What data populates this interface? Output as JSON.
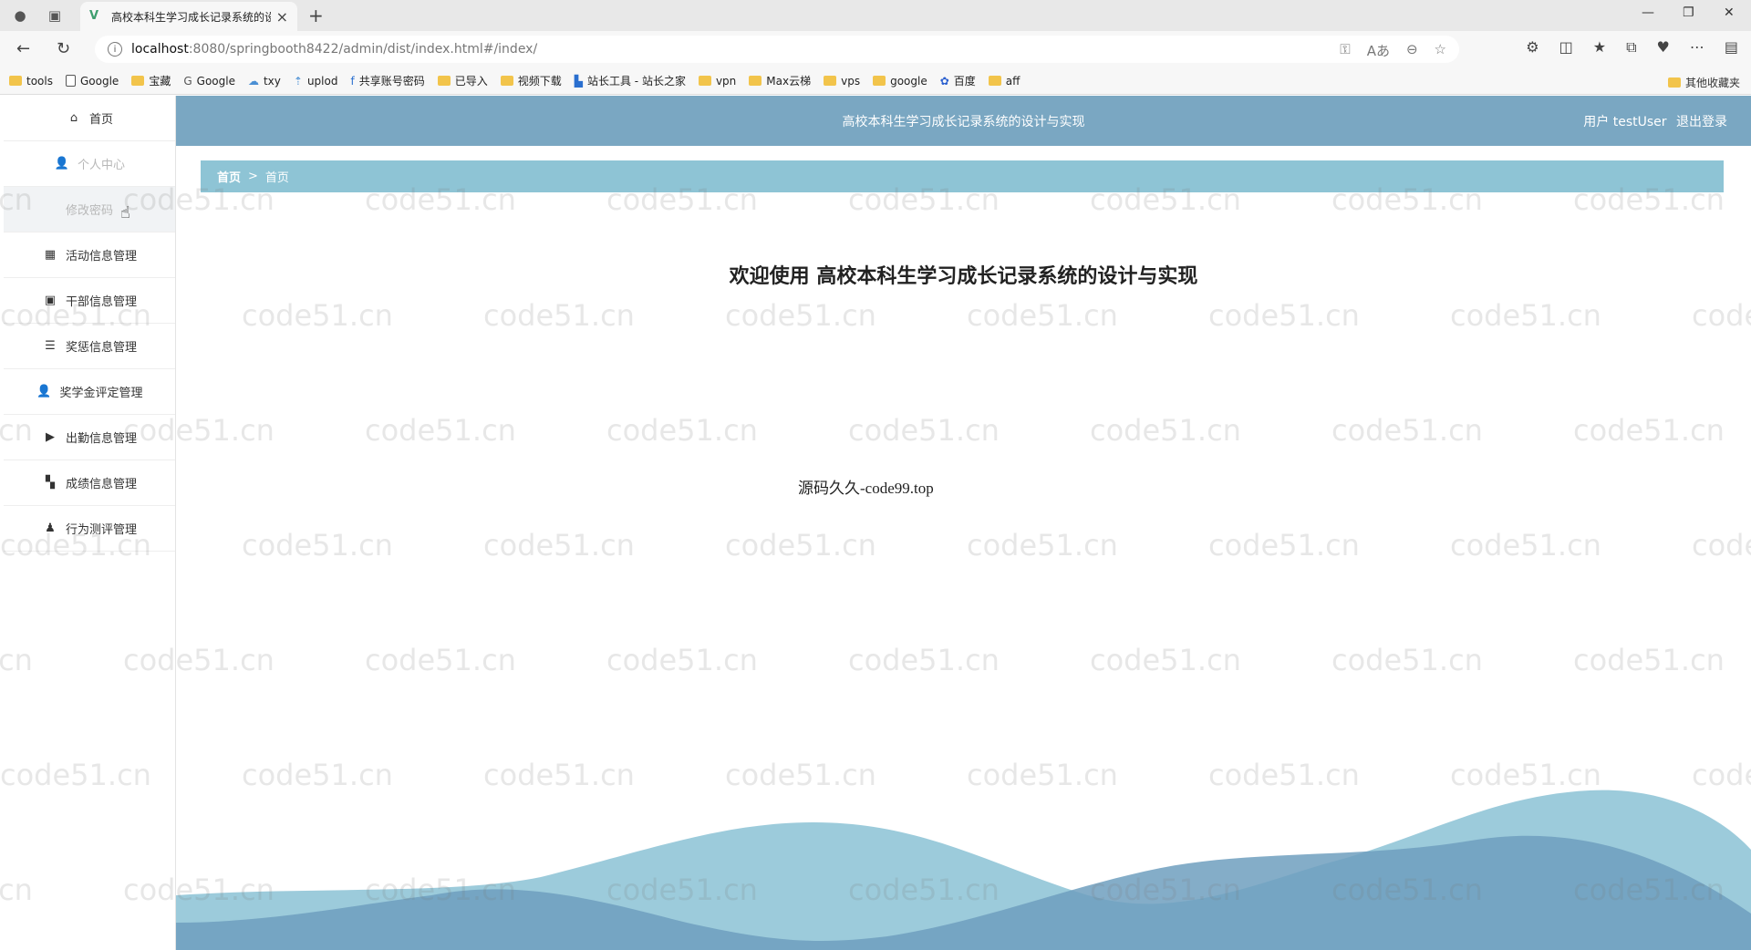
{
  "browser": {
    "tab_title": "高校本科生学习成长记录系统的设",
    "url_host": "localhost",
    "url_path": ":8080/springbooth8422/admin/dist/index.html#/index/",
    "bookmarks": [
      "tools",
      "Google",
      "宝藏",
      "Google",
      "txy",
      "uplod",
      "共享账号密码",
      "已导入",
      "视频下载",
      "站长工具 - 站长之家",
      "vpn",
      "Max云梯",
      "vps",
      "google",
      "百度",
      "aff"
    ],
    "other_bookmarks": "其他收藏夹"
  },
  "sidebar": {
    "home": "首页",
    "personal_center": "个人中心",
    "change_password": "修改密码",
    "items": [
      {
        "label": "活动信息管理",
        "icon": "grid-icon"
      },
      {
        "label": "干部信息管理",
        "icon": "box-icon"
      },
      {
        "label": "奖惩信息管理",
        "icon": "list-icon"
      },
      {
        "label": "奖学金评定管理",
        "icon": "user-icon"
      },
      {
        "label": "出勤信息管理",
        "icon": "camera-icon"
      },
      {
        "label": "成绩信息管理",
        "icon": "squares-icon"
      },
      {
        "label": "行为测评管理",
        "icon": "user-upload-icon"
      }
    ]
  },
  "header": {
    "title": "高校本科生学习成长记录系统的设计与实现",
    "user_label": "用户 testUser",
    "logout": "退出登录"
  },
  "breadcrumb": {
    "root": "首页",
    "sep": ">",
    "current": "首页"
  },
  "main": {
    "welcome": "欢迎使用 高校本科生学习成长记录系统的设计与实现",
    "source_text": "源码久久-code99.top"
  },
  "watermark": "code51.cn",
  "colors": {
    "header": "#7aa7c2",
    "breadcrumb": "#8ec4d5",
    "wave_light": "#9ccbdb",
    "wave_dark": "#6f9fbe"
  }
}
